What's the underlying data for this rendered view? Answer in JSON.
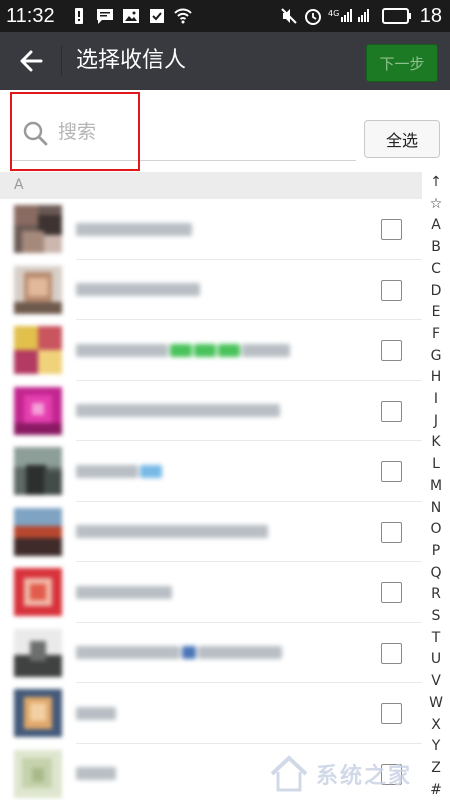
{
  "status_bar": {
    "time": "11:32",
    "network_label": "4G",
    "battery_level": "18"
  },
  "header": {
    "title": "选择收信人",
    "next_label": "下一步"
  },
  "search": {
    "placeholder": "搜索",
    "value": ""
  },
  "select_all_label": "全选",
  "section": {
    "letter": "A"
  },
  "contacts": [
    {
      "name_hidden": true,
      "checked": false
    },
    {
      "name_hidden": true,
      "checked": false
    },
    {
      "name_hidden": true,
      "checked": false
    },
    {
      "name_hidden": true,
      "checked": false
    },
    {
      "name_hidden": true,
      "checked": false
    },
    {
      "name_hidden": true,
      "checked": false
    },
    {
      "name_hidden": true,
      "checked": false
    },
    {
      "name_hidden": true,
      "checked": false
    },
    {
      "name_hidden": true,
      "checked": false
    },
    {
      "name_hidden": true,
      "checked": false
    }
  ],
  "index_bar": [
    "↑",
    "☆",
    "A",
    "B",
    "C",
    "D",
    "E",
    "F",
    "G",
    "H",
    "I",
    "J",
    "K",
    "L",
    "M",
    "N",
    "O",
    "P",
    "Q",
    "R",
    "S",
    "T",
    "U",
    "V",
    "W",
    "X",
    "Y",
    "Z",
    "#"
  ],
  "watermark": {
    "text": "系统之家"
  },
  "colors": {
    "title_bar": "#393a3f",
    "next_button": "#1d7a24",
    "highlight_box": "#e0181c"
  }
}
